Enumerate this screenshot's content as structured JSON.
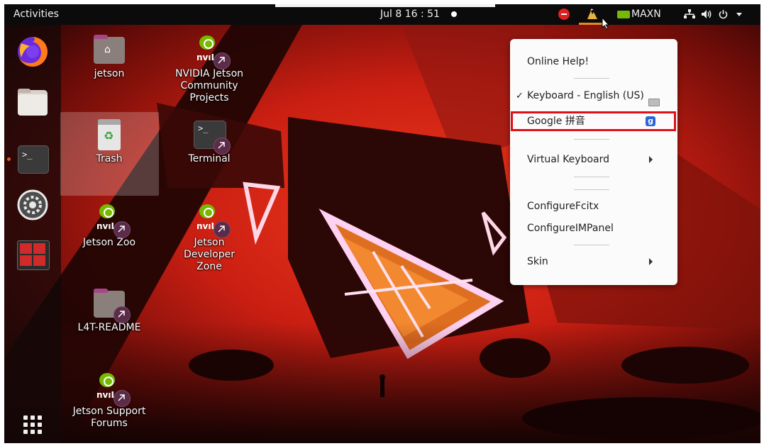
{
  "topbar": {
    "activities_label": "Activities",
    "clock": "Jul 8  16 : 51",
    "power_mode": "MAXN",
    "icons": [
      "do-not-disturb-icon",
      "input-method-icon",
      "nvidia-icon",
      "network-icon",
      "volume-icon",
      "power-icon",
      "chevron-down-icon"
    ]
  },
  "dock": {
    "items": [
      "firefox",
      "files",
      "terminal",
      "settings",
      "system-monitor"
    ],
    "show_apps_icon": "grid-icon"
  },
  "desktop": {
    "icons": [
      {
        "label": "jetson",
        "icon": "home-folder-icon"
      },
      {
        "label": "NVIDIA Jetson Community Projects",
        "icon": "nvidia-link-icon"
      },
      {
        "label": "Trash",
        "icon": "trash-icon"
      },
      {
        "label": "Terminal",
        "icon": "terminal-link-icon"
      },
      {
        "label": "Jetson Zoo",
        "icon": "nvidia-link-icon"
      },
      {
        "label": "Jetson Developer Zone",
        "icon": "nvidia-link-icon"
      },
      {
        "label": "L4T-README",
        "icon": "folder-link-icon"
      },
      {
        "label": "Jetson Support Forums",
        "icon": "nvidia-link-icon"
      }
    ]
  },
  "menu": {
    "items": [
      {
        "label": "Online Help!"
      },
      {
        "label": "Keyboard - English (US)",
        "checked": true
      },
      {
        "label": "Google 拼音",
        "highlighted": true
      },
      {
        "label": "Virtual Keyboard",
        "submenu": true
      },
      {
        "label": "ConfigureFcitx"
      },
      {
        "label": "ConfigureIMPanel"
      },
      {
        "label": "Skin",
        "submenu": true
      }
    ],
    "check_mark": "✓",
    "google_badge": "g"
  },
  "colors": {
    "topbar": "#0b0b0b",
    "accent_orange": "#e9541e",
    "highlight_red": "#e0101a",
    "nvidia_green": "#76b900"
  }
}
